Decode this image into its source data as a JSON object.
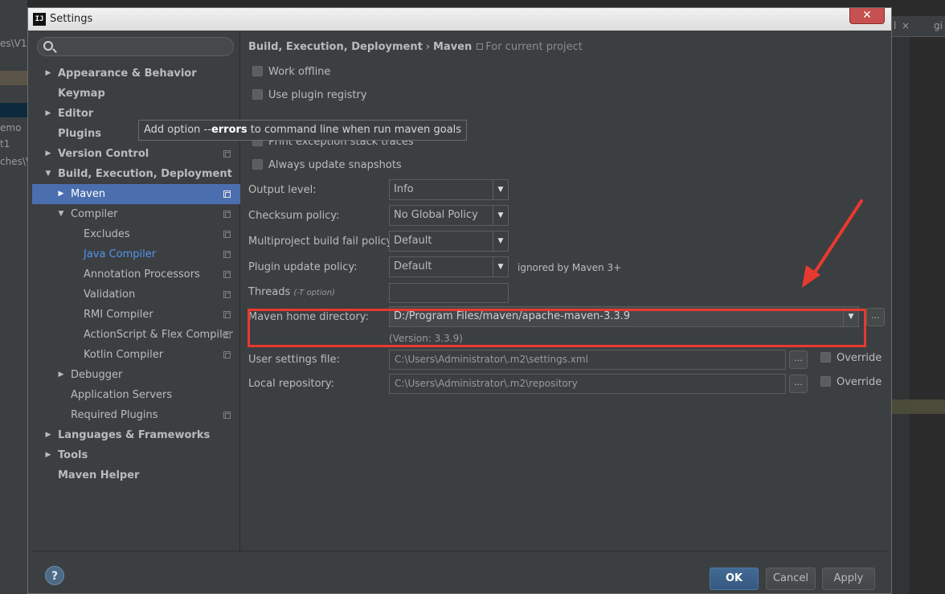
{
  "background": {
    "left_fragments": [
      "es\\V1",
      "emo",
      "t1",
      "ches\\V1"
    ],
    "right_tab_fragments": [
      "l",
      "×",
      "gi"
    ]
  },
  "dialog": {
    "title": "Settings",
    "app_icon": "IJ",
    "close_glyph": "✕"
  },
  "search": {
    "placeholder": "",
    "value": ""
  },
  "sidebar": {
    "items": [
      {
        "label": "Appearance & Behavior",
        "arrow": "▶",
        "bold": true,
        "proj": false
      },
      {
        "label": "Keymap",
        "arrow": "",
        "bold": true,
        "proj": false
      },
      {
        "label": "Editor",
        "arrow": "▶",
        "bold": true,
        "proj": false
      },
      {
        "label": "Plugins",
        "arrow": "",
        "bold": true,
        "proj": false
      },
      {
        "label": "Version Control",
        "arrow": "▶",
        "bold": true,
        "proj": true
      },
      {
        "label": "Build, Execution, Deployment",
        "arrow": "▼",
        "bold": true,
        "proj": false
      },
      {
        "label": "Maven",
        "arrow": "▶",
        "bold": false,
        "proj": true,
        "selected": true
      },
      {
        "label": "Compiler",
        "arrow": "▼",
        "bold": false,
        "proj": true
      },
      {
        "label": "Excludes",
        "arrow": "",
        "bold": false,
        "proj": true
      },
      {
        "label": "Java Compiler",
        "arrow": "",
        "bold": false,
        "proj": true,
        "link": true
      },
      {
        "label": "Annotation Processors",
        "arrow": "",
        "bold": false,
        "proj": true
      },
      {
        "label": "Validation",
        "arrow": "",
        "bold": false,
        "proj": true
      },
      {
        "label": "RMI Compiler",
        "arrow": "",
        "bold": false,
        "proj": true
      },
      {
        "label": "ActionScript & Flex Compiler",
        "arrow": "",
        "bold": false,
        "proj": true
      },
      {
        "label": "Kotlin Compiler",
        "arrow": "",
        "bold": false,
        "proj": true
      },
      {
        "label": "Debugger",
        "arrow": "▶",
        "bold": false,
        "proj": false
      },
      {
        "label": "Application Servers",
        "arrow": "",
        "bold": false,
        "proj": false
      },
      {
        "label": "Required Plugins",
        "arrow": "",
        "bold": false,
        "proj": true
      },
      {
        "label": "Languages & Frameworks",
        "arrow": "▶",
        "bold": true,
        "proj": false
      },
      {
        "label": "Tools",
        "arrow": "▶",
        "bold": true,
        "proj": false
      },
      {
        "label": "Maven Helper",
        "arrow": "",
        "bold": true,
        "proj": false
      }
    ]
  },
  "breadcrumb": {
    "parent": "Build, Execution, Deployment",
    "separator": "›",
    "current": "Maven",
    "scope": "For current project"
  },
  "options": {
    "work_offline": "Work offline",
    "use_plugin_registry": "Use plugin registry",
    "print_exception": "Print exception stack traces",
    "always_update": "Always update snapshots"
  },
  "tooltip": {
    "prefix": "Add option --",
    "bold": "errors",
    "suffix": " to command line when run maven goals"
  },
  "form": {
    "output_level": {
      "label": "Output level:",
      "value": "Info"
    },
    "checksum_policy": {
      "label": "Checksum policy:",
      "value": "No Global Policy"
    },
    "multiproject_fail_policy": {
      "label": "Multiproject build fail policy:",
      "value": "Default"
    },
    "plugin_update_policy": {
      "label": "Plugin update policy:",
      "value": "Default",
      "note": "ignored by Maven 3+"
    },
    "threads": {
      "label": "Threads ",
      "hint": "(-T option)",
      "value": ""
    },
    "maven_home": {
      "label": "Maven home directory:",
      "value": "D:/Program Files/maven/apache-maven-3.3.9",
      "version": "(Version: 3.3.9)"
    },
    "user_settings": {
      "label": "User settings file:",
      "value": "C:\\Users\\Administrator\\.m2\\settings.xml",
      "override": "Override"
    },
    "local_repo": {
      "label": "Local repository:",
      "value": "C:\\Users\\Administrator\\.m2\\repository",
      "override": "Override"
    },
    "browse_glyph": "..."
  },
  "footer": {
    "help": "?",
    "ok": "OK",
    "cancel": "Cancel",
    "apply": "Apply"
  },
  "colors": {
    "accent_selected": "#4b6eaf",
    "link": "#5394ec",
    "annotation_red": "#e8392f",
    "primary_button": "#365880"
  }
}
